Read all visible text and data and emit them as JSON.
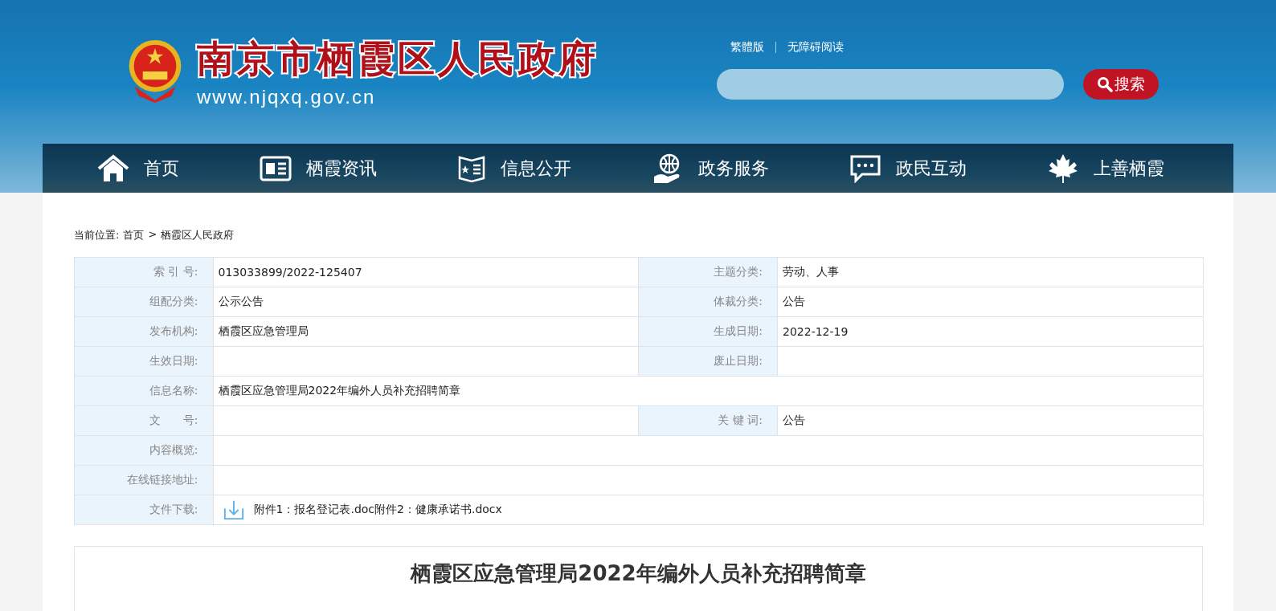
{
  "header": {
    "site_name": "南京市栖霞区人民政府",
    "site_url": "www.njqxq.gov.cn",
    "top_links": [
      "繁體版",
      "无障碍阅读"
    ],
    "search": {
      "button": "搜索"
    }
  },
  "nav": [
    {
      "label": "首页",
      "kind": "home"
    },
    {
      "label": "栖霞资讯",
      "kind": "news"
    },
    {
      "label": "信息公开",
      "kind": "publicity"
    },
    {
      "label": "政务服务",
      "kind": "service"
    },
    {
      "label": "政民互动",
      "kind": "interaction"
    },
    {
      "label": "上善栖霞",
      "kind": "culture"
    }
  ],
  "breadcrumb": {
    "label": "当前位置:",
    "items": [
      "首页",
      "栖霞区人民政府"
    ],
    "separator": ">"
  },
  "info_table": [
    {
      "kind": "pair",
      "cells": [
        {
          "label": "索 引 号:",
          "value": "013033899/2022-125407"
        },
        {
          "label": "主题分类:",
          "value": "劳动、人事"
        }
      ]
    },
    {
      "kind": "pair",
      "cells": [
        {
          "label": "组配分类:",
          "value": "公示公告"
        },
        {
          "label": "体裁分类:",
          "value": "公告"
        }
      ]
    },
    {
      "kind": "pair",
      "cells": [
        {
          "label": "发布机构:",
          "value": "栖霞区应急管理局"
        },
        {
          "label": "生成日期:",
          "value": "2022-12-19"
        }
      ]
    },
    {
      "kind": "pair",
      "cells": [
        {
          "label": "生效日期:"
        },
        {
          "label": "废止日期:"
        }
      ]
    },
    {
      "kind": "full",
      "cells": [
        {
          "label": "信息名称:",
          "value": "栖霞区应急管理局2022年编外人员补充招聘简章"
        }
      ]
    },
    {
      "kind": "pair",
      "cells": [
        {
          "label": "文　　号:"
        },
        {
          "label": "关 键 词:",
          "value": "公告"
        }
      ]
    },
    {
      "kind": "full",
      "cells": [
        {
          "label": "内容概览:"
        }
      ]
    },
    {
      "kind": "full",
      "cells": [
        {
          "label": "在线链接地址:"
        }
      ]
    },
    {
      "kind": "files",
      "cells": [
        {
          "label": "文件下载:",
          "files": [
            "附件1：报名登记表.doc",
            "附件2：健康承诺书.docx"
          ]
        }
      ]
    }
  ],
  "article": {
    "title": "栖霞区应急管理局2022年编外人员补充招聘简章"
  }
}
